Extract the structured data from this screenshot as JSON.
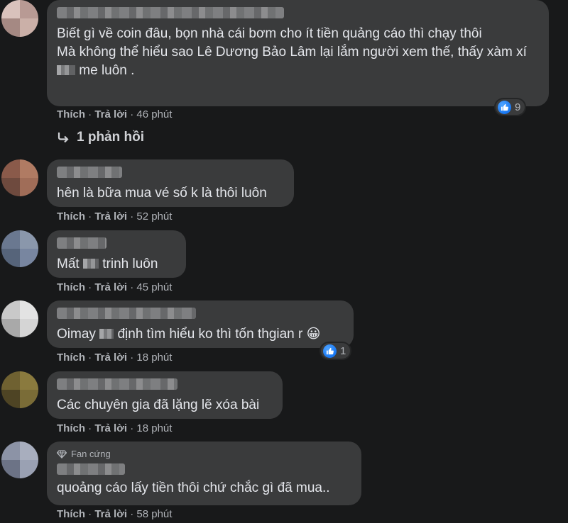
{
  "comments": [
    {
      "text_before": "Biết gì về coin đâu, bọn nhà cái bơm cho ít tiền quảng cáo thì chạy thôi\nMà không thể hiểu sao Lê Dương Bảo Lâm lại lắm người xem thế, thấy xàm xí",
      "text_mid": "me luôn .",
      "like_label": "Thích",
      "reply_label": "Trả lời",
      "time": "46 phút",
      "reactions": "9",
      "replies_label": "1 phản hồi"
    },
    {
      "text": "hên là bữa mua vé số k là thôi luôn",
      "like_label": "Thích",
      "reply_label": "Trả lời",
      "time": "52 phút"
    },
    {
      "text_before": "Mất",
      "text_after": "trinh luôn",
      "like_label": "Thích",
      "reply_label": "Trả lời",
      "time": "45 phút"
    },
    {
      "text_before": "Oimay",
      "text_after": "định tìm hiểu ko thì tốn thgian r",
      "emoji": "😀",
      "like_label": "Thích",
      "reply_label": "Trả lời",
      "time": "18 phút",
      "reactions": "1"
    },
    {
      "text": "Các chuyên gia đã lặng lẽ xóa bài",
      "like_label": "Thích",
      "reply_label": "Trả lời",
      "time": "18 phút"
    },
    {
      "badge": "Fan cứng",
      "text": "quoảng cáo lấy tiền thôi chứ chắc gì đã mua..",
      "like_label": "Thích",
      "reply_label": "Trả lời",
      "time": "58 phút"
    }
  ],
  "separator": "·",
  "colors": {
    "background": "#18191a",
    "bubble": "#3a3b3c",
    "text": "#e4e6eb",
    "meta": "#b0b3b8",
    "like_blue": "#1877f2"
  },
  "icons": [
    "like-icon",
    "reply-arrow-icon",
    "gem-icon"
  ]
}
